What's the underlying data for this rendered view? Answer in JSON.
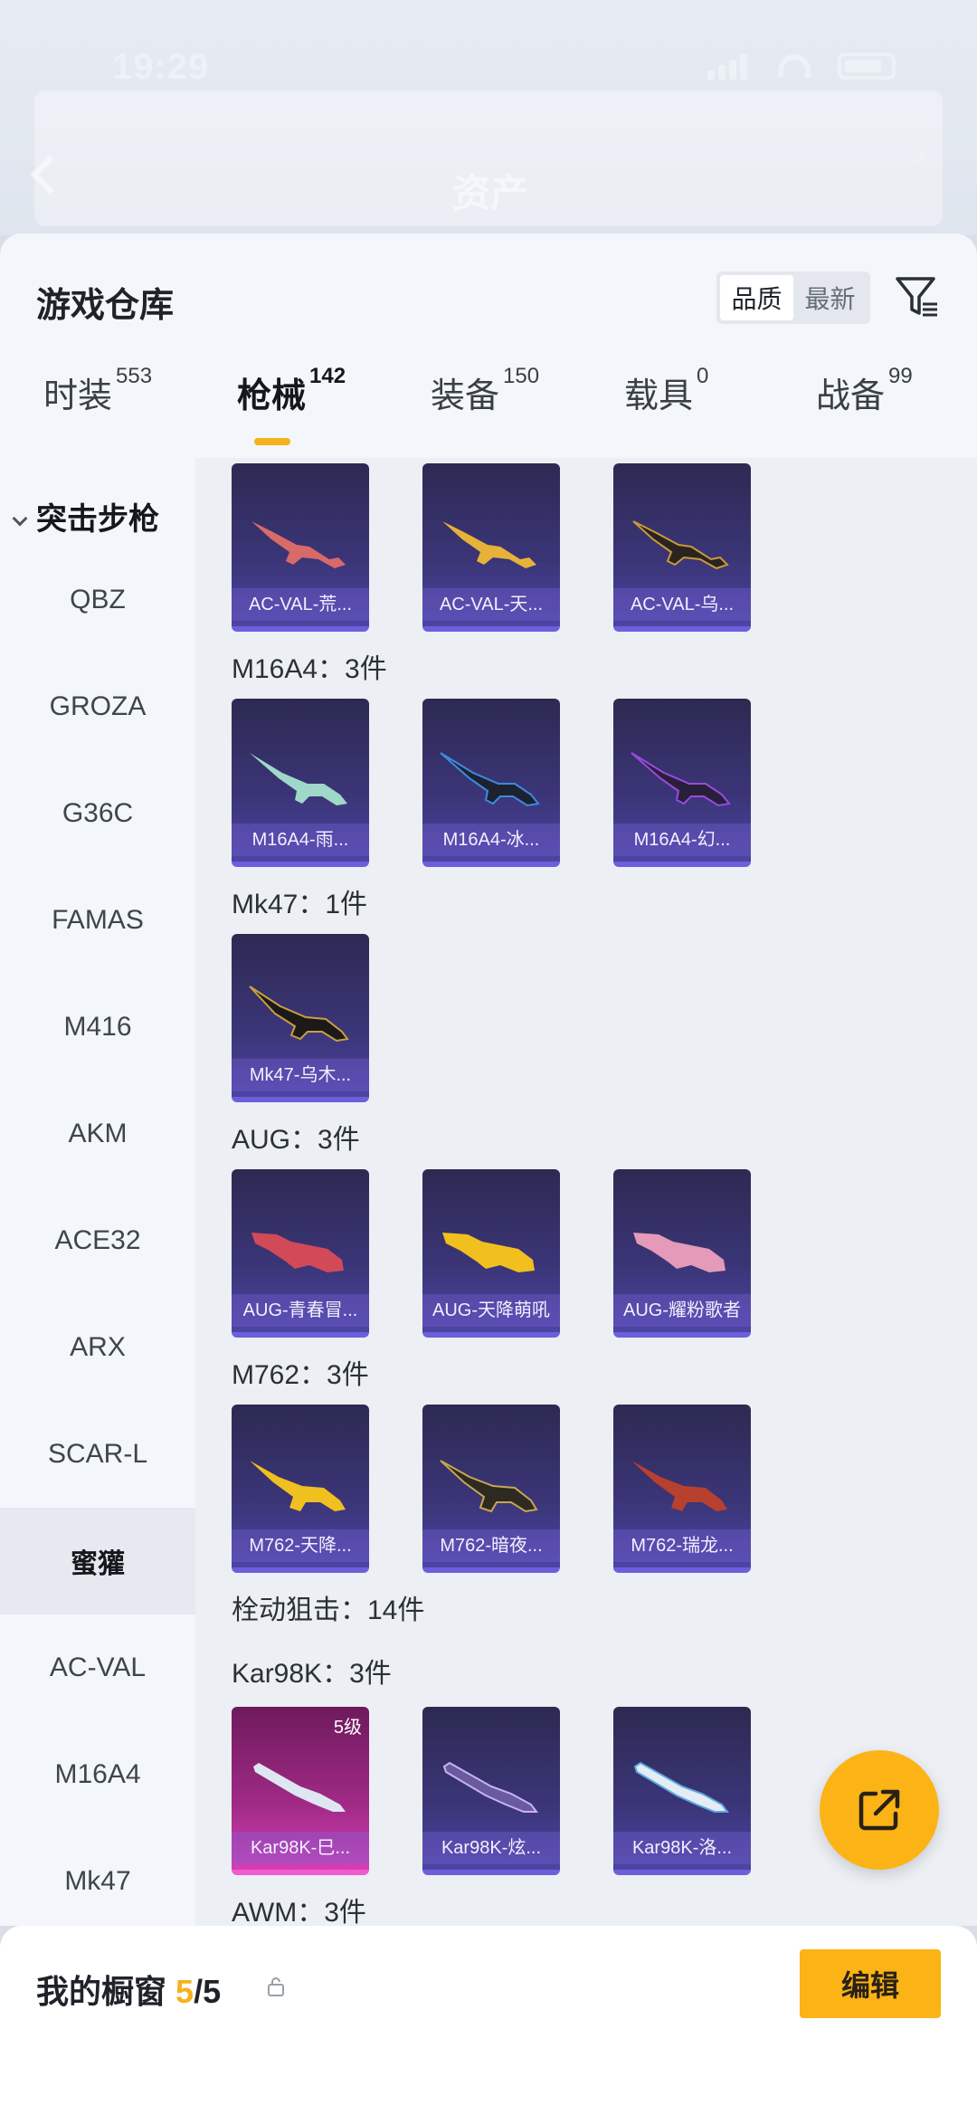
{
  "status": {
    "time": "19:29"
  },
  "header": {
    "asset_title": "资产"
  },
  "sheet": {
    "title": "游戏仓库",
    "sort_options": [
      "品质",
      "最新"
    ],
    "tabs": [
      {
        "label": "时装",
        "count": "553"
      },
      {
        "label": "枪械",
        "count": "142"
      },
      {
        "label": "装备",
        "count": "150"
      },
      {
        "label": "载具",
        "count": "0"
      },
      {
        "label": "战备",
        "count": "99"
      }
    ]
  },
  "sidebar": {
    "header": "突击步枪",
    "items": [
      "QBZ",
      "GROZA",
      "G36C",
      "FAMAS",
      "M416",
      "AKM",
      "ACE32",
      "ARX",
      "SCAR-L",
      "蜜獾",
      "AC-VAL",
      "M16A4",
      "Mk47"
    ],
    "active_index": 9
  },
  "groups": {
    "acval": {
      "cards": [
        "AC-VAL-荒...",
        "AC-VAL-天...",
        "AC-VAL-乌..."
      ]
    },
    "m16a4": {
      "label": "M16A4：3件",
      "cards": [
        "M16A4-雨...",
        "M16A4-冰...",
        "M16A4-幻..."
      ]
    },
    "mk47": {
      "label": "Mk47：1件",
      "cards": [
        "Mk47-乌木..."
      ]
    },
    "aug": {
      "label": "AUG：3件",
      "cards": [
        "AUG-青春冒...",
        "AUG-天降萌吼",
        "AUG-耀粉歌者"
      ]
    },
    "m762": {
      "label": "M762：3件",
      "cards": [
        "M762-天降...",
        "M762-暗夜...",
        "M762-瑞龙..."
      ]
    },
    "bolt": {
      "label": "栓动狙击：14件"
    },
    "kar98k": {
      "label": "Kar98K：3件",
      "cards": [
        "Kar98K-巳...",
        "Kar98K-炫...",
        "Kar98K-洛..."
      ],
      "level": "5级"
    },
    "awm": {
      "label": "AWM：3件"
    }
  },
  "bottom": {
    "title": "我的橱窗",
    "count_current": "5",
    "count_total": "/5",
    "edit_label": "编辑"
  },
  "colors": {
    "accent": "#fbb316",
    "card_purple": "#3b3578",
    "card_pink": "#d63fb3"
  }
}
